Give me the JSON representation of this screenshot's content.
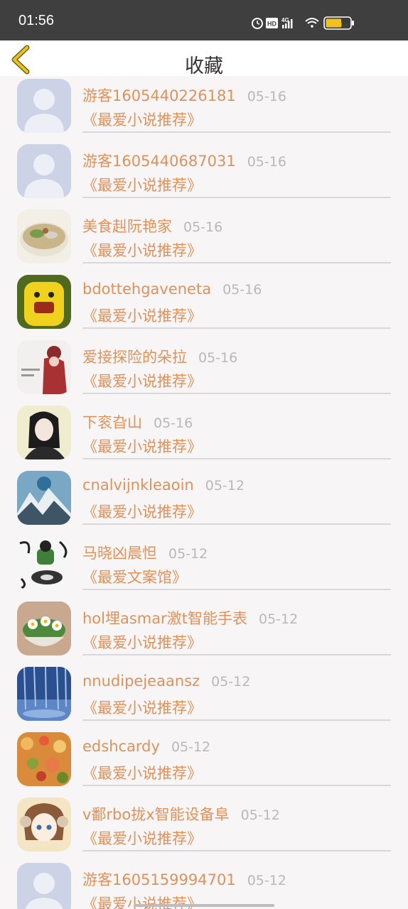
{
  "status_bar": {
    "time": "01:56",
    "battery": "65",
    "network": "4G",
    "hd": "HD"
  },
  "header": {
    "title": "收藏",
    "accent_color": "#e0b400"
  },
  "items": [
    {
      "user": "游客1605440226181",
      "date": "05-16",
      "subtitle": "《最爱小说推荐》",
      "avatar": "default-avatar-icon"
    },
    {
      "user": "游客1605440687031",
      "date": "05-16",
      "subtitle": "《最爱小说推荐》",
      "avatar": "default-avatar-icon"
    },
    {
      "user": "美食赳阮艳家",
      "date": "05-16",
      "subtitle": "《最爱小说推荐》",
      "avatar": "food-bowl-avatar"
    },
    {
      "user": "bdottehgaveneta",
      "date": "05-16",
      "subtitle": "《最爱小说推荐》",
      "avatar": "yellow-toy-avatar"
    },
    {
      "user": "爱接探险的朵拉",
      "date": "05-16",
      "subtitle": "《最爱小说推荐》",
      "avatar": "red-hood-avatar"
    },
    {
      "user": "下衮旮山",
      "date": "05-16",
      "subtitle": "《最爱小说推荐》",
      "avatar": "woman-portrait-avatar"
    },
    {
      "user": "cnalvijnkleaoin",
      "date": "05-12",
      "subtitle": "《最爱小说推荐》",
      "avatar": "mountain-avatar"
    },
    {
      "user": "马晓凶晨怛",
      "date": "05-12",
      "subtitle": "《最爱文案馆》",
      "avatar": "dj-cartoon-avatar"
    },
    {
      "user": "hol埋asmar激t智能手表",
      "date": "05-12",
      "subtitle": "《最爱小说推荐》",
      "avatar": "daisy-pot-avatar"
    },
    {
      "user": "nnudipejeaansz",
      "date": "05-12",
      "subtitle": "《最爱小说推荐》",
      "avatar": "blue-forest-avatar"
    },
    {
      "user": "edshcardy",
      "date": "05-12",
      "subtitle": "《最爱小说推荐》",
      "avatar": "flowers-bokeh-avatar"
    },
    {
      "user": "v鄱rbo拢x智能设备阜",
      "date": "05-12",
      "subtitle": "《最爱小说推荐》",
      "avatar": "anime-girl-avatar"
    },
    {
      "user": "游客1605159994701",
      "date": "05-12",
      "subtitle": "《最爱小说推荐》",
      "avatar": "default-avatar-icon"
    }
  ]
}
